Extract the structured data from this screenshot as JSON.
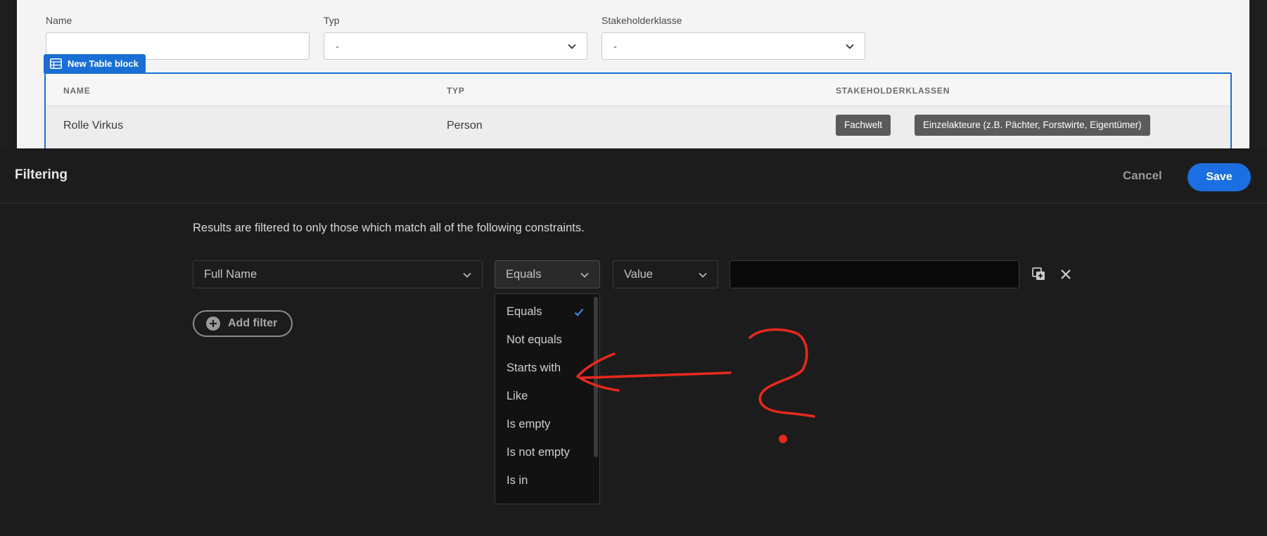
{
  "form": {
    "name_label": "Name",
    "name_value": "",
    "typ_label": "Typ",
    "typ_value": "-",
    "stakeholder_label": "Stakeholderklasse",
    "stakeholder_value": "-"
  },
  "table_block": {
    "tag_label": "New Table block",
    "columns": [
      "NAME",
      "TYP",
      "STAKEHOLDERKLASSEN"
    ],
    "rows": [
      {
        "name": "Rolle Virkus",
        "typ": "Person",
        "badges": [
          "Fachwelt",
          "Einzelakteure (z.B. Pächter, Forstwirte, Eigentümer)"
        ]
      }
    ]
  },
  "panel": {
    "title": "Filtering",
    "cancel_label": "Cancel",
    "save_label": "Save",
    "description": "Results are filtered to only those which match all of the following constraints.",
    "filter": {
      "field": "Full Name",
      "operator": "Equals",
      "value_type": "Value",
      "value": ""
    },
    "add_filter_label": "Add filter",
    "operator_options": [
      "Equals",
      "Not equals",
      "Starts with",
      "Like",
      "Is empty",
      "Is not empty",
      "Is in"
    ],
    "selected_operator": "Equals"
  },
  "colors": {
    "accent": "#1b6fe0",
    "block_blue": "#1a6fd6",
    "annotation_red": "#e8291c",
    "panel_bg": "#1c1c1c"
  }
}
